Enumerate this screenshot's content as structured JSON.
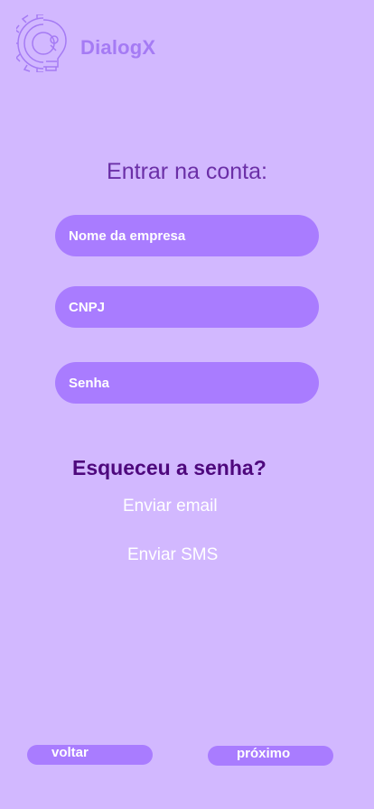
{
  "brand": {
    "name": "DialogX",
    "logo_icon": "gear-bulb-icon"
  },
  "login": {
    "title": "Entrar na conta:",
    "company_placeholder": "Nome da empresa",
    "cnpj_placeholder": "CNPJ",
    "password_placeholder": "Senha"
  },
  "forgot": {
    "heading": "Esqueceu a senha?",
    "email_label": "Enviar email",
    "sms_label": "Enviar SMS"
  },
  "nav": {
    "back_label": "voltar",
    "next_label": "próximo"
  },
  "colors": {
    "background": "#d2b8ff",
    "field": "#a97cff",
    "brand": "#a57bf4",
    "title": "#6b2fa7",
    "heading": "#4e087d"
  }
}
